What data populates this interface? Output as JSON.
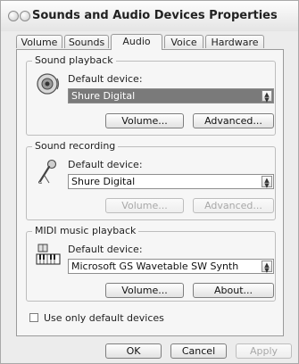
{
  "window": {
    "title": "Sounds and Audio Devices Properties"
  },
  "tabs": [
    {
      "label": "Volume"
    },
    {
      "label": "Sounds"
    },
    {
      "label": "Audio"
    },
    {
      "label": "Voice"
    },
    {
      "label": "Hardware"
    }
  ],
  "active_tab": "Audio",
  "sound_playback": {
    "title": "Sound playback",
    "device_label": "Default device:",
    "device_value": "Shure Digital",
    "volume_button": "Volume...",
    "advanced_button": "Advanced..."
  },
  "sound_recording": {
    "title": "Sound recording",
    "device_label": "Default device:",
    "device_value": "Shure Digital",
    "volume_button": "Volume...",
    "advanced_button": "Advanced..."
  },
  "midi_playback": {
    "title": "MIDI music playback",
    "device_label": "Default device:",
    "device_value": "Microsoft GS Wavetable SW Synth",
    "volume_button": "Volume...",
    "about_button": "About..."
  },
  "use_only_default": {
    "label": "Use only default devices",
    "checked": false
  },
  "footer": {
    "ok": "OK",
    "cancel": "Cancel",
    "apply": "Apply"
  }
}
